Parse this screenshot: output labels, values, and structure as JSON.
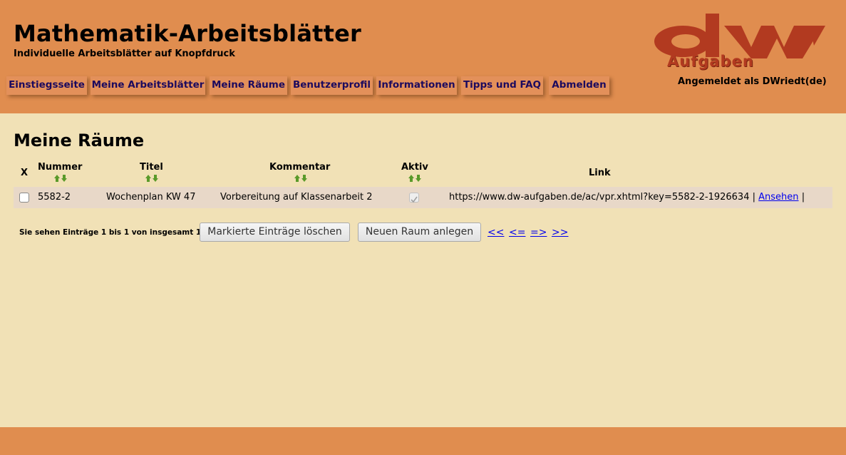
{
  "header": {
    "title": "Mathematik-Arbeitsblätter",
    "subtitle": "Individuelle Arbeitsblätter auf Knopfdruck",
    "logo_text": "Aufgaben",
    "login_status": "Angemeldet als DWriedt(de)"
  },
  "nav": {
    "items": [
      {
        "label": "Einstiegsseite"
      },
      {
        "label": "Meine Arbeitsblätter"
      },
      {
        "label": "Meine Räume"
      },
      {
        "label": "Benutzerprofil"
      },
      {
        "label": "Informationen"
      },
      {
        "label": "Tipps und FAQ"
      },
      {
        "label": "Abmelden"
      }
    ]
  },
  "main": {
    "heading": "Meine Räume",
    "table": {
      "headers": {
        "x": "X",
        "nummer": "Nummer",
        "titel": "Titel",
        "kommentar": "Kommentar",
        "aktiv": "Aktiv",
        "link": "Link"
      },
      "rows": [
        {
          "nummer": "5582-2",
          "titel": "Wochenplan KW 47",
          "kommentar": "Vorbereitung auf Klassenarbeit 2",
          "link": "https://www.dw-aufgaben.de/ac/vpr.xhtml?key=5582-2-1926634",
          "separator": "|",
          "view_label": "Ansehen",
          "separator_end": "|"
        }
      ]
    },
    "pager": {
      "info": "Sie sehen Einträge 1 bis 1 von insgesamt 1.",
      "delete_button": "Markierte Einträge löschen",
      "new_button": "Neuen Raum anlegen",
      "first": "<<",
      "prev": "<=",
      "next": "=>",
      "last": ">>"
    }
  },
  "colors": {
    "header_bg": "#e08d4f",
    "page_bg": "#f1e1b6",
    "nav_text": "#1c0a5e",
    "logo_red": "#b23a20",
    "row_bg": "#e8d8c8",
    "link": "#0000ee"
  },
  "icons": {
    "sort": "sort-arrows-icon",
    "logo": "dw-logo"
  }
}
